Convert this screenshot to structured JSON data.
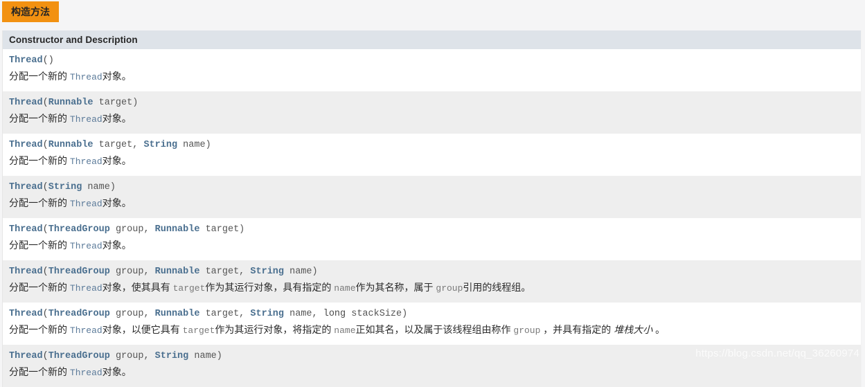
{
  "tab": {
    "label": "构造方法",
    "accent_color": "#f29111",
    "text_color": "#252525"
  },
  "table": {
    "header": "Constructor and Description",
    "header_bg": "#dee3e9",
    "row_bg": "#ffffff",
    "row_alt_bg": "#eeeeee",
    "type_link_color": "#4a6f8f",
    "rows": [
      {
        "signature_parts": [
          {
            "text": "Thread",
            "kind": "type"
          },
          {
            "text": "()",
            "kind": "punct"
          }
        ],
        "description_parts": [
          {
            "text": "分配一个新的 ",
            "kind": "text"
          },
          {
            "text": "Thread",
            "kind": "codelink"
          },
          {
            "text": "对象。",
            "kind": "text"
          }
        ]
      },
      {
        "signature_parts": [
          {
            "text": "Thread",
            "kind": "type"
          },
          {
            "text": "(",
            "kind": "punct"
          },
          {
            "text": "Runnable",
            "kind": "type"
          },
          {
            "text": " target)",
            "kind": "param"
          }
        ],
        "description_parts": [
          {
            "text": "分配一个新的 ",
            "kind": "text"
          },
          {
            "text": "Thread",
            "kind": "codelink"
          },
          {
            "text": "对象。",
            "kind": "text"
          }
        ]
      },
      {
        "signature_parts": [
          {
            "text": "Thread",
            "kind": "type"
          },
          {
            "text": "(",
            "kind": "punct"
          },
          {
            "text": "Runnable",
            "kind": "type"
          },
          {
            "text": " target, ",
            "kind": "param"
          },
          {
            "text": "String",
            "kind": "type"
          },
          {
            "text": " name)",
            "kind": "param"
          }
        ],
        "description_parts": [
          {
            "text": "分配一个新的 ",
            "kind": "text"
          },
          {
            "text": "Thread",
            "kind": "codelink"
          },
          {
            "text": "对象。",
            "kind": "text"
          }
        ]
      },
      {
        "signature_parts": [
          {
            "text": "Thread",
            "kind": "type"
          },
          {
            "text": "(",
            "kind": "punct"
          },
          {
            "text": "String",
            "kind": "type"
          },
          {
            "text": " name)",
            "kind": "param"
          }
        ],
        "description_parts": [
          {
            "text": "分配一个新的 ",
            "kind": "text"
          },
          {
            "text": "Thread",
            "kind": "codelink"
          },
          {
            "text": "对象。",
            "kind": "text"
          }
        ]
      },
      {
        "signature_parts": [
          {
            "text": "Thread",
            "kind": "type"
          },
          {
            "text": "(",
            "kind": "punct"
          },
          {
            "text": "ThreadGroup",
            "kind": "type"
          },
          {
            "text": " group, ",
            "kind": "param"
          },
          {
            "text": "Runnable",
            "kind": "type"
          },
          {
            "text": " target)",
            "kind": "param"
          }
        ],
        "description_parts": [
          {
            "text": "分配一个新的 ",
            "kind": "text"
          },
          {
            "text": "Thread",
            "kind": "codelink"
          },
          {
            "text": "对象。",
            "kind": "text"
          }
        ]
      },
      {
        "signature_parts": [
          {
            "text": "Thread",
            "kind": "type"
          },
          {
            "text": "(",
            "kind": "punct"
          },
          {
            "text": "ThreadGroup",
            "kind": "type"
          },
          {
            "text": " group, ",
            "kind": "param"
          },
          {
            "text": "Runnable",
            "kind": "type"
          },
          {
            "text": " target, ",
            "kind": "param"
          },
          {
            "text": "String",
            "kind": "type"
          },
          {
            "text": " name)",
            "kind": "param"
          }
        ],
        "description_parts": [
          {
            "text": "分配一个新的 ",
            "kind": "text"
          },
          {
            "text": "Thread",
            "kind": "codelink"
          },
          {
            "text": "对象，使其具有 ",
            "kind": "text"
          },
          {
            "text": "target",
            "kind": "code"
          },
          {
            "text": "作为其运行对象，具有指定的 ",
            "kind": "text"
          },
          {
            "text": "name",
            "kind": "code"
          },
          {
            "text": "作为其名称，属于 ",
            "kind": "text"
          },
          {
            "text": "group",
            "kind": "code"
          },
          {
            "text": "引用的线程组。",
            "kind": "text"
          }
        ]
      },
      {
        "signature_parts": [
          {
            "text": "Thread",
            "kind": "type"
          },
          {
            "text": "(",
            "kind": "punct"
          },
          {
            "text": "ThreadGroup",
            "kind": "type"
          },
          {
            "text": " group, ",
            "kind": "param"
          },
          {
            "text": "Runnable",
            "kind": "type"
          },
          {
            "text": " target, ",
            "kind": "param"
          },
          {
            "text": "String",
            "kind": "type"
          },
          {
            "text": " name, ",
            "kind": "param"
          },
          {
            "text": "long",
            "kind": "kw"
          },
          {
            "text": " stackSize)",
            "kind": "param"
          }
        ],
        "description_parts": [
          {
            "text": "分配一个新的 ",
            "kind": "text"
          },
          {
            "text": "Thread",
            "kind": "codelink"
          },
          {
            "text": "对象，以便它具有 ",
            "kind": "text"
          },
          {
            "text": "target",
            "kind": "code"
          },
          {
            "text": "作为其运行对象，将指定的 ",
            "kind": "text"
          },
          {
            "text": "name",
            "kind": "code"
          },
          {
            "text": "正如其名，以及属于该线程组由称作 ",
            "kind": "text"
          },
          {
            "text": "group",
            "kind": "code"
          },
          {
            "text": " ，并具有指定的 ",
            "kind": "text"
          },
          {
            "text": "堆栈大小",
            "kind": "em"
          },
          {
            "text": " 。",
            "kind": "text"
          }
        ]
      },
      {
        "signature_parts": [
          {
            "text": "Thread",
            "kind": "type"
          },
          {
            "text": "(",
            "kind": "punct"
          },
          {
            "text": "ThreadGroup",
            "kind": "type"
          },
          {
            "text": " group, ",
            "kind": "param"
          },
          {
            "text": "String",
            "kind": "type"
          },
          {
            "text": " name)",
            "kind": "param"
          }
        ],
        "description_parts": [
          {
            "text": "分配一个新的 ",
            "kind": "text"
          },
          {
            "text": "Thread",
            "kind": "codelink"
          },
          {
            "text": "对象。",
            "kind": "text"
          }
        ]
      }
    ]
  },
  "watermark": {
    "text": "https://blog.csdn.net/qq_36260974"
  }
}
